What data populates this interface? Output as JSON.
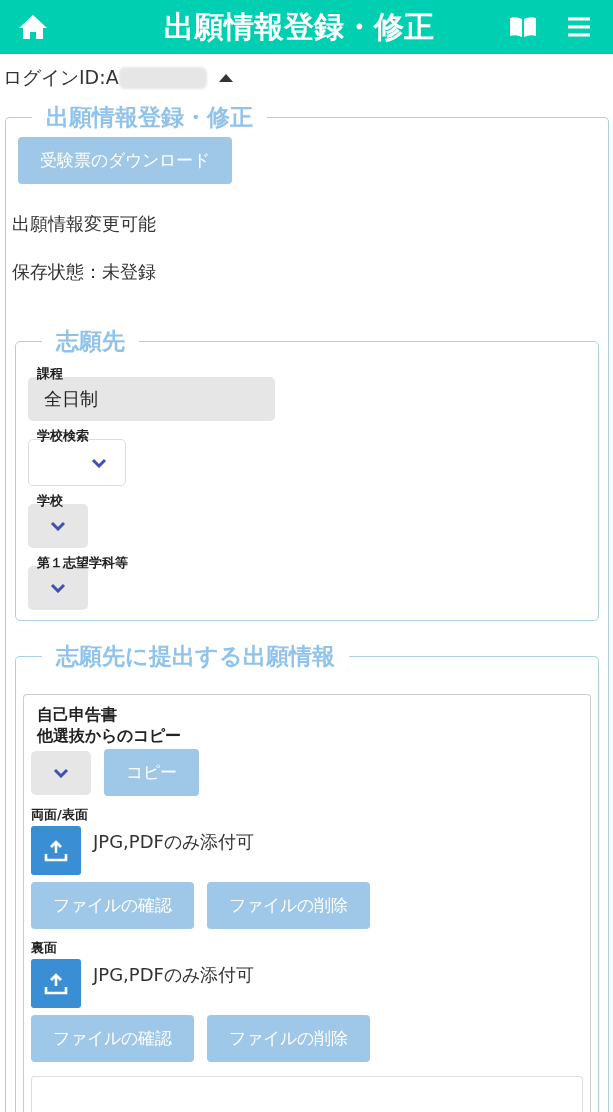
{
  "header": {
    "title": "出願情報登録・修正"
  },
  "login": {
    "label": "ログインID:A",
    "expanded": true
  },
  "main": {
    "legend": "出願情報登録・修正",
    "download_button": "受験票のダウンロード",
    "status_lines": [
      "出願情報変更可能",
      "保存状態：未登録"
    ],
    "destination": {
      "legend": "志願先",
      "fields": [
        {
          "kind": "text",
          "label": "課程",
          "value": "全日制"
        },
        {
          "kind": "select",
          "label": "学校検索",
          "disabled": false
        },
        {
          "kind": "select",
          "label": "学校",
          "disabled": true
        },
        {
          "kind": "select",
          "label": "第１志望学科等",
          "disabled": true
        }
      ]
    },
    "application": {
      "legend": "志願先に提出する出願情報",
      "document": {
        "title": "自己申告書",
        "copy_label": "他選抜からのコピー",
        "copy_button": "コピー",
        "uploads": [
          {
            "label": "両面/表面",
            "note": "JPG,PDFのみ添付可",
            "buttons": [
              "ファイルの確認",
              "ファイルの削除"
            ]
          },
          {
            "label": "裏面",
            "note": "JPG,PDFのみ添付可",
            "buttons": [
              "ファイルの確認",
              "ファイルの削除"
            ]
          }
        ]
      }
    }
  }
}
